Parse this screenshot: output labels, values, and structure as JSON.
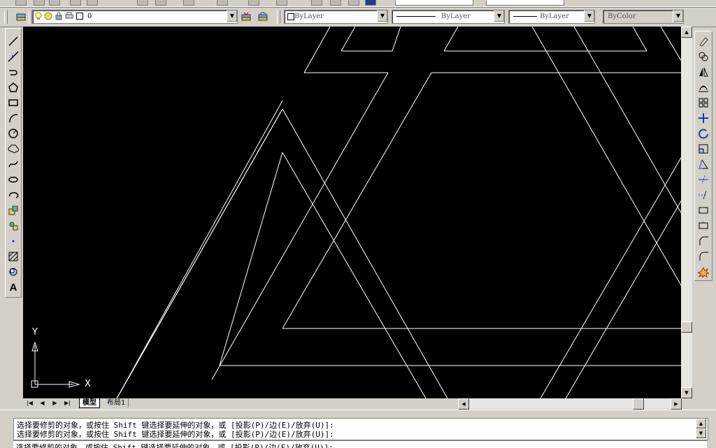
{
  "properties_toolbar": {
    "layer_name": "0",
    "color": "ByLayer",
    "linetype": "ByLayer",
    "lineweight": "ByLayer",
    "plot_style": "ByColor"
  },
  "left_toolbar_icons": [
    "line-icon",
    "construction-line-icon",
    "polyline-icon",
    "polygon-icon",
    "rectangle-icon",
    "arc-icon",
    "circle-icon",
    "revision-cloud-icon",
    "spline-icon",
    "ellipse-icon",
    "ellipse-arc-icon",
    "insert-block-icon",
    "make-block-icon",
    "point-icon",
    "hatch-icon",
    "region-icon",
    "multiline-text-icon"
  ],
  "right_toolbar_icons": [
    "erase-icon",
    "copy-icon",
    "mirror-icon",
    "offset-icon",
    "array-icon",
    "move-icon",
    "rotate-icon",
    "scale-icon",
    "stretch-icon",
    "trim-icon",
    "extend-icon",
    "break-at-point-icon",
    "break-icon",
    "chamfer-icon",
    "fillet-icon",
    "explode-icon"
  ],
  "ucs": {
    "x_label": "X",
    "y_label": "Y"
  },
  "tabs": {
    "model": "模型",
    "layout1": "布局1"
  },
  "command_lines": [
    "选择要修剪的对象，或按住 Shift 键选择要延伸的对象，或 [投影(P)/边(E)/放弃(U)]:",
    "选择要修剪的对象，或按住 Shift 键选择要延伸的对象，或 [投影(P)/边(E)/放弃(U)]:",
    "选择要修剪的对象，或按住 Shift 键选择要延伸的对象，或 [投影(P)/边(E)/放弃(U)]:"
  ],
  "colors": {
    "canvas_background": "#000000",
    "geometry": "#ffffff",
    "chrome": "#d4d0c8"
  }
}
